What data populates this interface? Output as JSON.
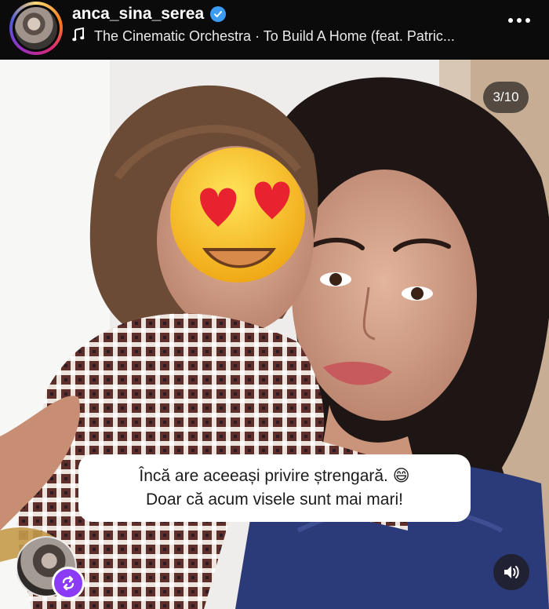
{
  "header": {
    "username": "anca_sina_serea",
    "verified": true,
    "music_icon": "music-note-icon",
    "music_text": "The Cinematic Orchestra · To Build A Home (feat. Patric...",
    "more_icon": "more-horizontal-icon"
  },
  "media": {
    "counter": "3/10",
    "emoji_icon": "heart-eyes-emoji-icon",
    "caption_line1": "Încă are aceeași privire ștrengară. 😄",
    "caption_line2": "Doar că acum visele sunt mai mari!"
  },
  "controls": {
    "remix_icon": "remix-icon",
    "sound_icon": "speaker-icon"
  },
  "colors": {
    "header_bg": "#0b0b0c",
    "verified_blue": "#3b9cf5",
    "remix_purple": "#8b3bf5"
  }
}
